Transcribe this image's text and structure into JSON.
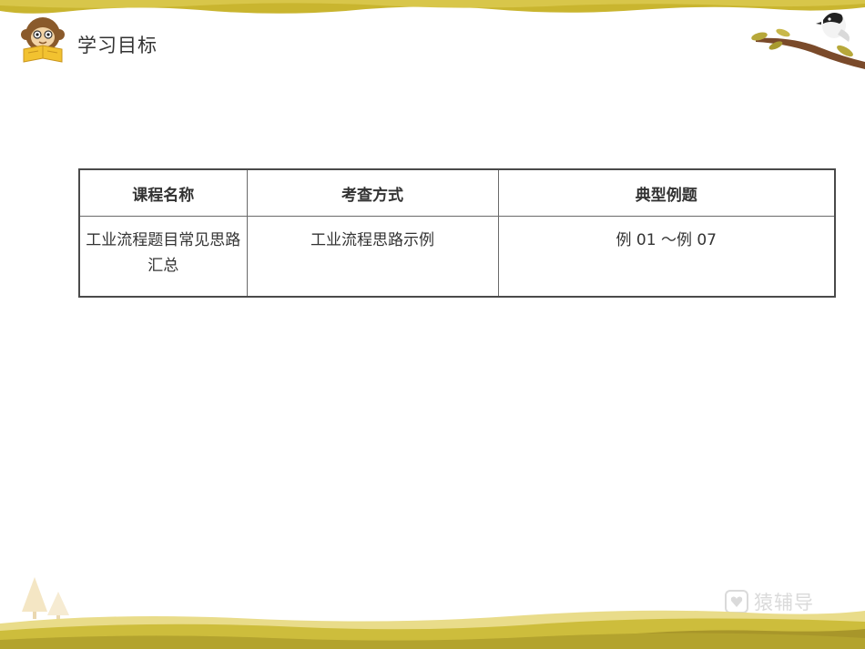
{
  "header": {
    "title": "学习目标"
  },
  "table": {
    "headers": [
      "课程名称",
      "考查方式",
      "典型例题"
    ],
    "rows": [
      [
        "工业流程题目常见思路汇总",
        "工业流程思路示例",
        "例 01 ～例 07"
      ]
    ]
  },
  "watermark": {
    "text": "猿辅导"
  },
  "colors": {
    "top_band": "#c9b52f",
    "bottom_band": "#b3a32e",
    "table_border": "#4a4a4a"
  }
}
